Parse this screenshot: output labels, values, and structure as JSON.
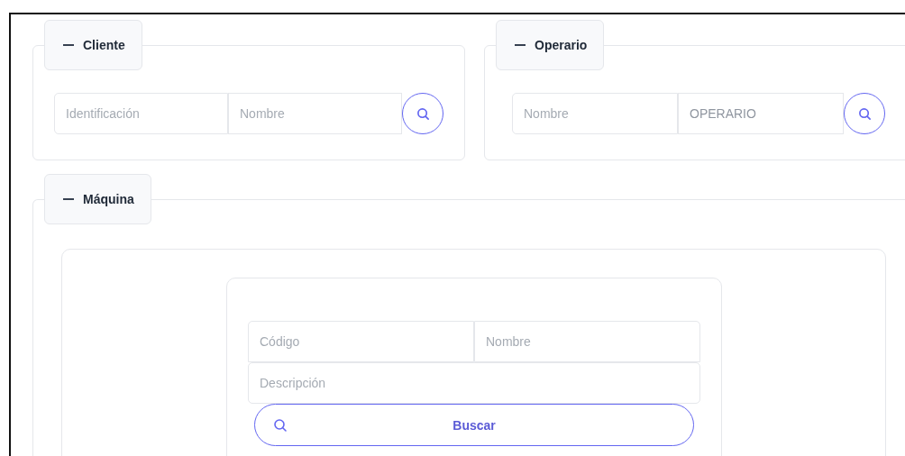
{
  "sections": [
    {
      "title": "Cliente",
      "expanded": true,
      "fields": [
        {
          "placeholder": "Identificación"
        },
        {
          "placeholder": "Nombre"
        }
      ]
    },
    {
      "title": "Operario",
      "expanded": true,
      "fields": [
        {
          "placeholder": "Nombre"
        },
        {
          "value": "OPERARIO"
        }
      ]
    }
  ],
  "machine": {
    "title": "Máquina",
    "expanded": true,
    "fields": [
      {
        "placeholder": "Código"
      },
      {
        "placeholder": "Nombre"
      },
      {
        "placeholder": "Descripción"
      }
    ],
    "button": "Buscar"
  }
}
